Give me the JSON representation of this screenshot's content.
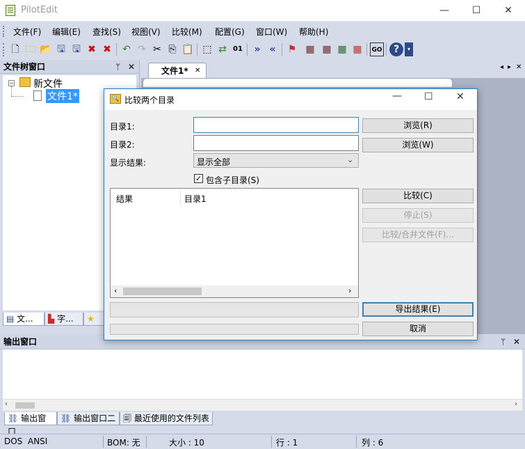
{
  "window": {
    "title": "PilotEdit",
    "minimize": "—",
    "maximize": "☐",
    "close": "✕"
  },
  "menu": [
    "文件(F)",
    "编辑(E)",
    "查找(S)",
    "视图(V)",
    "比较(M)",
    "配置(G)",
    "窗口(W)",
    "帮助(H)"
  ],
  "file_tree": {
    "title": "文件树窗口",
    "pin": "ᛘ",
    "close": "✕",
    "root": "新文件",
    "child": "文件1*",
    "tabs": [
      "文...",
      "字...",
      ""
    ]
  },
  "doc_tab": {
    "label": "文件1*",
    "close": "✕",
    "nav_left": "◂",
    "nav_right": "▸",
    "nav_close": "✕"
  },
  "dialog": {
    "title": "比较两个目录",
    "dir1_label": "目录1:",
    "dir2_label": "目录2:",
    "show_label": "显示结果:",
    "dir1_value": "",
    "dir2_value": "",
    "show_value": "显示全部",
    "include_sub": "包含子目录(S)",
    "include_sub_checked": true,
    "col_result": "结果",
    "col_dir1": "目录1",
    "browse1": "浏览(R)",
    "browse2": "浏览(W)",
    "compare": "比较(C)",
    "stop": "停止(S)",
    "compare_merge": "比较/合并文件(F)...",
    "export": "导出结果(E)",
    "cancel": "取消"
  },
  "output": {
    "title": "输出窗口",
    "pin": "ᛘ",
    "close": "✕",
    "tabs": [
      "输出窗口",
      "输出窗口二",
      "最近使用的文件列表"
    ]
  },
  "status": {
    "eol": "DOS",
    "encoding": "ANSI",
    "bom": "BOM: 无",
    "size": "大小 : 10",
    "line": "行 : 1",
    "col": "列 : 6"
  },
  "colors": {
    "accent": "#1883d7",
    "chrome": "#d6dbe9",
    "selection": "#3399ff"
  }
}
